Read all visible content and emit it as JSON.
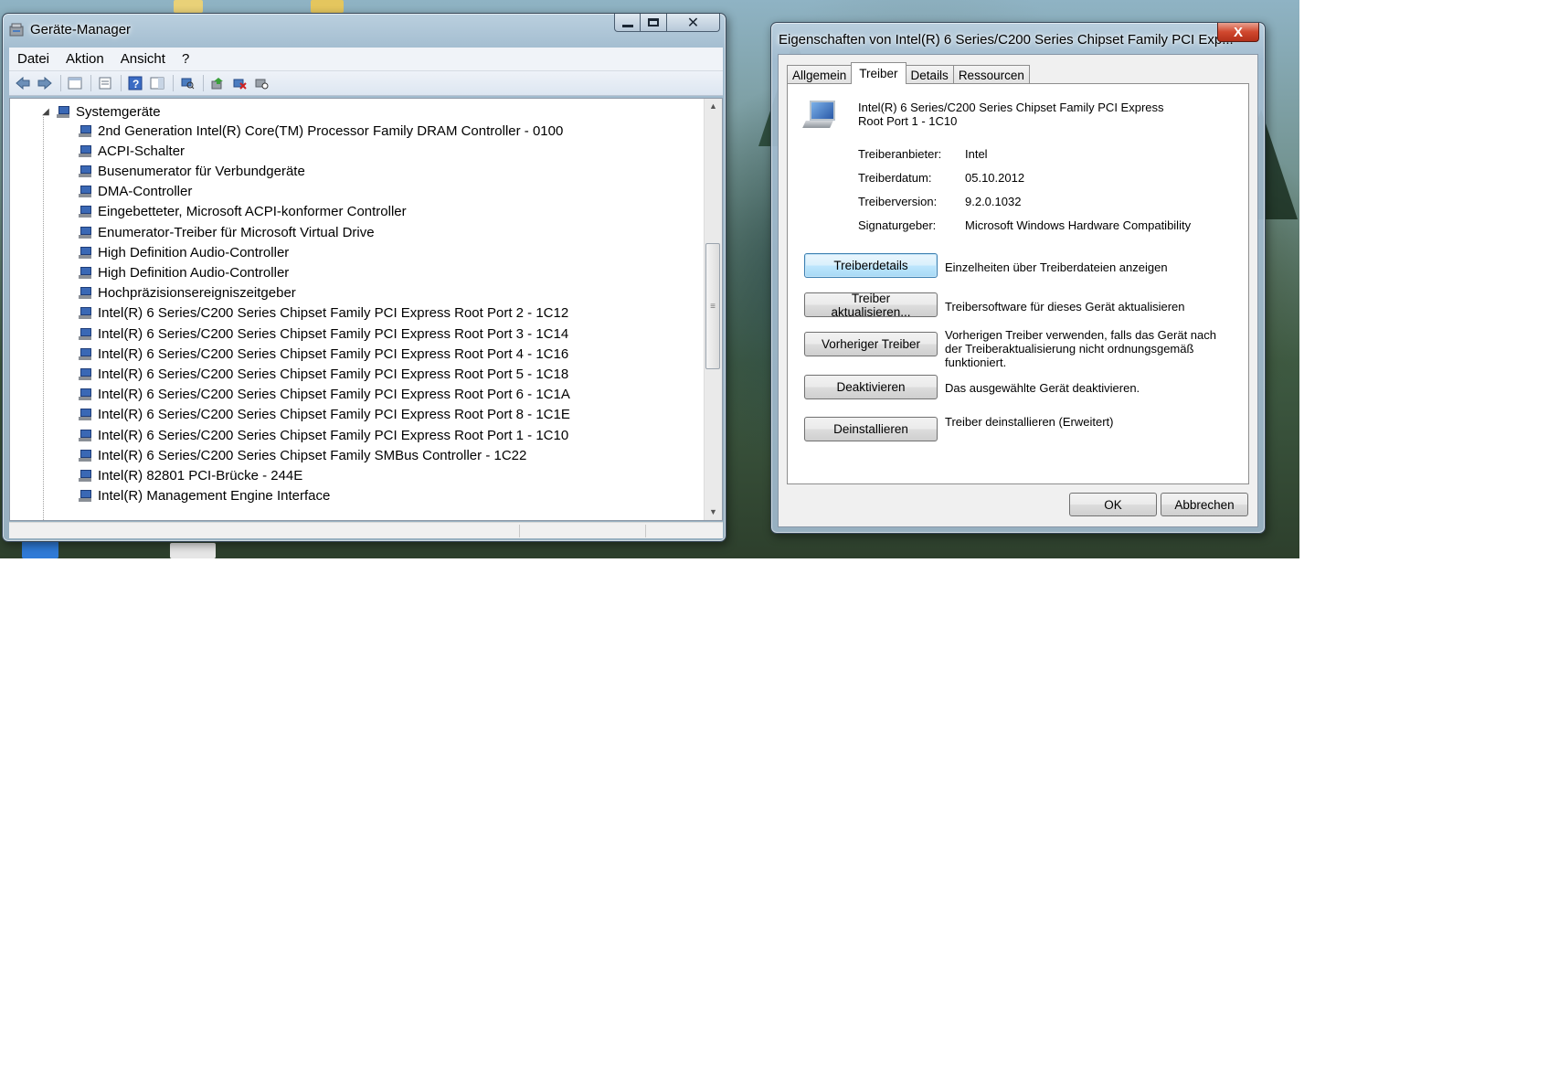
{
  "device_manager": {
    "title": "Geräte-Manager",
    "menu": [
      "Datei",
      "Aktion",
      "Ansicht",
      "?"
    ],
    "toolbar_icons": [
      "back-arrow-icon",
      "forward-arrow-icon",
      "show-hide-console-tree-icon",
      "properties-icon",
      "help-icon",
      "action-pane-icon",
      "scan-hardware-icon",
      "update-driver-icon",
      "uninstall-icon",
      "disable-device-icon"
    ],
    "tree": {
      "category": "Systemgeräte",
      "devices": [
        "2nd Generation Intel(R) Core(TM) Processor Family DRAM Controller - 0100",
        "ACPI-Schalter",
        "Busenumerator für Verbundgeräte",
        "DMA-Controller",
        "Eingebetteter, Microsoft ACPI-konformer Controller",
        "Enumerator-Treiber für Microsoft Virtual Drive",
        "High Definition Audio-Controller",
        "High Definition Audio-Controller",
        "Hochpräzisionsereigniszeitgeber",
        "Intel(R) 6 Series/C200 Series Chipset Family PCI Express Root Port 2 - 1C12",
        "Intel(R) 6 Series/C200 Series Chipset Family PCI Express Root Port 3 - 1C14",
        "Intel(R) 6 Series/C200 Series Chipset Family PCI Express Root Port 4 - 1C16",
        "Intel(R) 6 Series/C200 Series Chipset Family PCI Express Root Port 5 - 1C18",
        "Intel(R) 6 Series/C200 Series Chipset Family PCI Express Root Port 6 - 1C1A",
        "Intel(R) 6 Series/C200 Series Chipset Family PCI Express Root Port 8 - 1C1E",
        "Intel(R) 6 Series/C200 Series Chipset Family PCI Express Root Port 1 - 1C10",
        "Intel(R) 6 Series/C200 Series Chipset Family SMBus Controller - 1C22",
        "Intel(R) 82801 PCI-Brücke - 244E",
        "Intel(R) Management Engine Interface"
      ]
    }
  },
  "properties": {
    "title": "Eigenschaften von Intel(R) 6 Series/C200 Series Chipset Family PCI Exp...",
    "close_label": "X",
    "tabs": [
      "Allgemein",
      "Treiber",
      "Details",
      "Ressourcen"
    ],
    "active_tab": "Treiber",
    "device_name_line1": "Intel(R) 6 Series/C200 Series Chipset Family PCI Express",
    "device_name_line2": "Root Port 1 - 1C10",
    "info": [
      {
        "label": "Treiberanbieter:",
        "value": "Intel"
      },
      {
        "label": "Treiberdatum:",
        "value": "05.10.2012"
      },
      {
        "label": "Treiberversion:",
        "value": "9.2.0.1032"
      },
      {
        "label": "Signaturgeber:",
        "value": "Microsoft Windows Hardware Compatibility"
      }
    ],
    "actions": [
      {
        "button": "Treiberdetails",
        "description": "Einzelheiten über Treiberdateien anzeigen"
      },
      {
        "button": "Treiber aktualisieren...",
        "description": "Treibersoftware für dieses Gerät aktualisieren"
      },
      {
        "button": "Vorheriger Treiber",
        "description": "Vorherigen Treiber verwenden, falls das Gerät nach der Treiberaktualisierung nicht ordnungsgemäß funktioniert."
      },
      {
        "button": "Deaktivieren",
        "description": "Das ausgewählte Gerät deaktivieren."
      },
      {
        "button": "Deinstallieren",
        "description": "Treiber deinstallieren (Erweitert)"
      }
    ],
    "ok_label": "OK",
    "cancel_label": "Abbrechen"
  }
}
